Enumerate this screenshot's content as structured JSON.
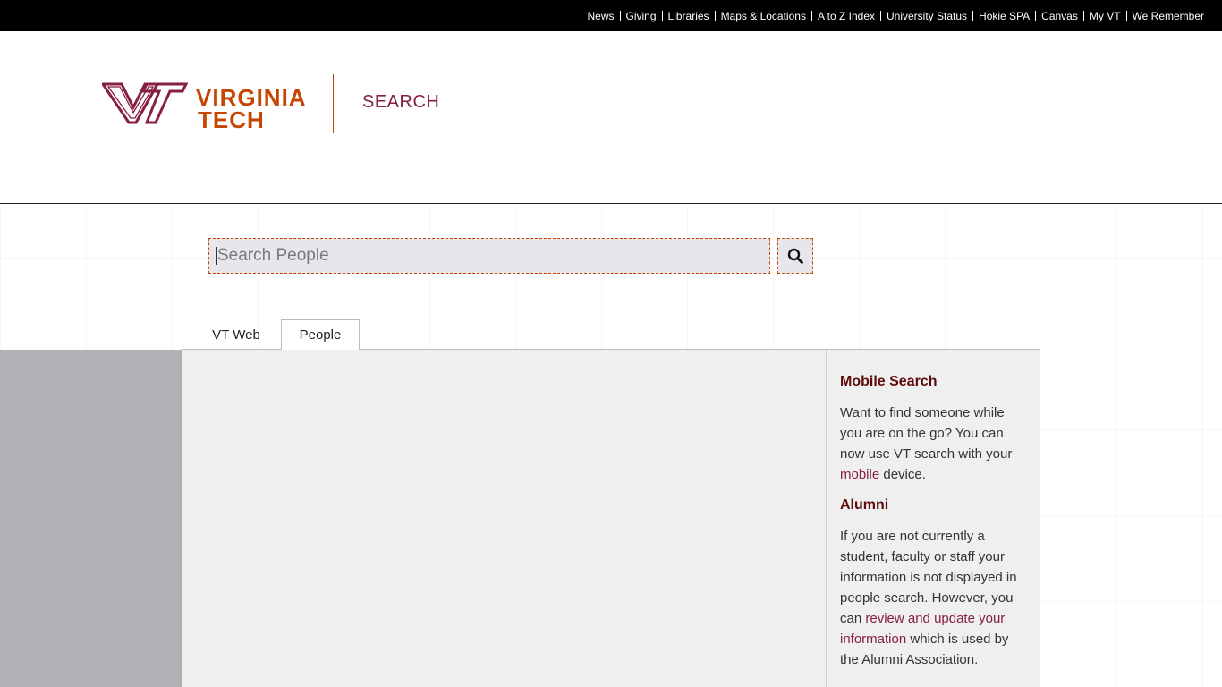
{
  "topbar": {
    "links": [
      "News",
      "Giving",
      "Libraries",
      "Maps & Locations",
      "A to Z Index",
      "University Status",
      "Hokie SPA",
      "Canvas",
      "My VT",
      "We Remember"
    ]
  },
  "header": {
    "logo_line1": "VIRGINIA",
    "logo_line2": "TECH",
    "logo_mark": "VT",
    "site_title": "SEARCH"
  },
  "search": {
    "placeholder": "Search People",
    "value": "",
    "button_icon": "search-icon"
  },
  "tabs": [
    {
      "label": "VT Web",
      "active": false
    },
    {
      "label": "People",
      "active": true
    }
  ],
  "sidebar": {
    "mobile": {
      "heading": "Mobile Search",
      "text_before": "Want to find someone while you are on the go? You can now use VT search with your ",
      "link": "mobile",
      "text_after": " device."
    },
    "alumni": {
      "heading": "Alumni",
      "text_before": "If you are not currently a student, faculty or staff your information is not displayed in people search. However, you can ",
      "link": "review and update your information",
      "text_after": " which is used by the Alumni Association."
    }
  },
  "colors": {
    "maroon": "#861f41",
    "orange": "#c64600",
    "heading": "#5e0b0b",
    "topbar": "#000000"
  }
}
